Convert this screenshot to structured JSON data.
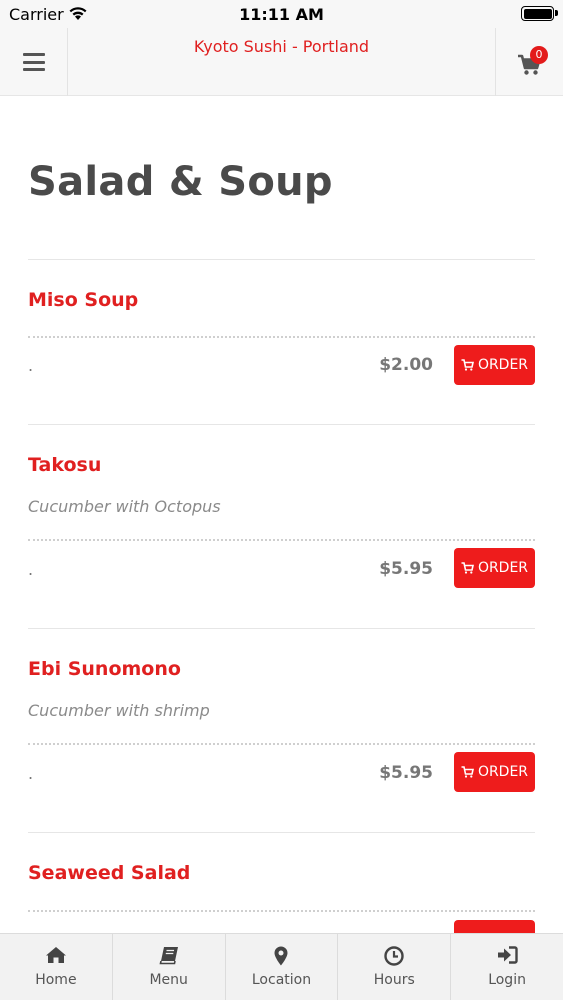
{
  "status_bar": {
    "carrier": "Carrier",
    "time": "11:11 AM"
  },
  "nav": {
    "title": "Kyoto Sushi - Portland",
    "cart_count": "0"
  },
  "section": {
    "title": "Salad & Soup"
  },
  "order_label": "ORDER",
  "items": [
    {
      "name": "Miso Soup",
      "description": "",
      "dot": ".",
      "price": "$2.00"
    },
    {
      "name": "Takosu",
      "description": "Cucumber with Octopus",
      "dot": ".",
      "price": "$5.95"
    },
    {
      "name": "Ebi Sunomono",
      "description": "Cucumber with shrimp",
      "dot": ".",
      "price": "$5.95"
    },
    {
      "name": "Seaweed Salad",
      "description": "",
      "dot": "",
      "price": ""
    }
  ],
  "tabs": [
    {
      "label": "Home",
      "icon": "home-icon"
    },
    {
      "label": "Menu",
      "icon": "book-icon"
    },
    {
      "label": "Location",
      "icon": "map-pin-icon"
    },
    {
      "label": "Hours",
      "icon": "clock-icon"
    },
    {
      "label": "Login",
      "icon": "sign-in-icon"
    }
  ],
  "colors": {
    "accent": "#e02020",
    "button": "#ee1c1c",
    "heading": "#4a4a4a"
  }
}
